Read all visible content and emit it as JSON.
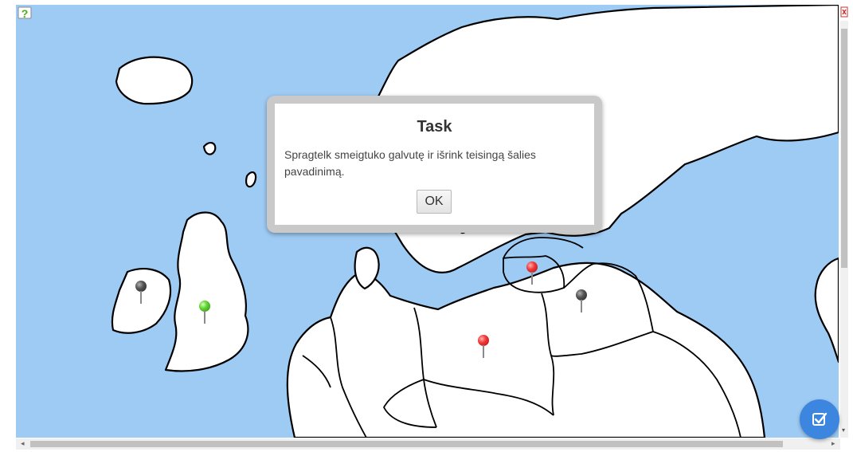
{
  "dialog": {
    "title": "Task",
    "message": "Spragtelk smeigtuko galvutę ir išrink teisingą šalies pavadinimą.",
    "ok_label": "OK"
  },
  "map": {
    "pins": [
      {
        "name": "pin-ireland",
        "color": "gray"
      },
      {
        "name": "pin-great-britain",
        "color": "green"
      },
      {
        "name": "pin-lithuania",
        "color": "red"
      },
      {
        "name": "pin-belarus",
        "color": "gray"
      },
      {
        "name": "pin-poland",
        "color": "red"
      }
    ]
  },
  "icons": {
    "help": "help-icon",
    "check": "check-icon"
  },
  "colors": {
    "sea": "#9ecbf4",
    "land": "#ffffff",
    "check_button": "#3d86e0"
  }
}
